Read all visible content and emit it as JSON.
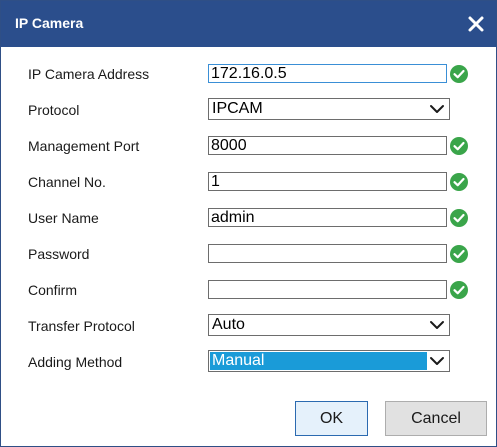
{
  "dialog": {
    "title": "IP Camera",
    "close_icon": "close-icon",
    "fields": {
      "ip_address": {
        "label": "IP Camera Address",
        "value": "172.16.0.5",
        "valid": true
      },
      "protocol": {
        "label": "Protocol",
        "value": "IPCAM"
      },
      "management_port": {
        "label": "Management Port",
        "value": "8000",
        "valid": true
      },
      "channel_no": {
        "label": "Channel No.",
        "value": "1",
        "valid": true
      },
      "user_name": {
        "label": "User Name",
        "value": "admin",
        "valid": true
      },
      "password": {
        "label": "Password",
        "value": "",
        "valid": true
      },
      "confirm": {
        "label": "Confirm",
        "value": "",
        "valid": true
      },
      "transfer_protocol": {
        "label": "Transfer Protocol",
        "value": "Auto"
      },
      "adding_method": {
        "label": "Adding Method",
        "value": "Manual"
      }
    },
    "buttons": {
      "ok": "OK",
      "cancel": "Cancel"
    },
    "colors": {
      "titlebar": "#2b4e8c",
      "valid_check": "#3aa54a",
      "selection_highlight": "#1a9bd8",
      "focus_border": "#3a8fd6"
    },
    "icons": {
      "valid": "check-circle-icon",
      "dropdown": "chevron-down-icon"
    }
  }
}
